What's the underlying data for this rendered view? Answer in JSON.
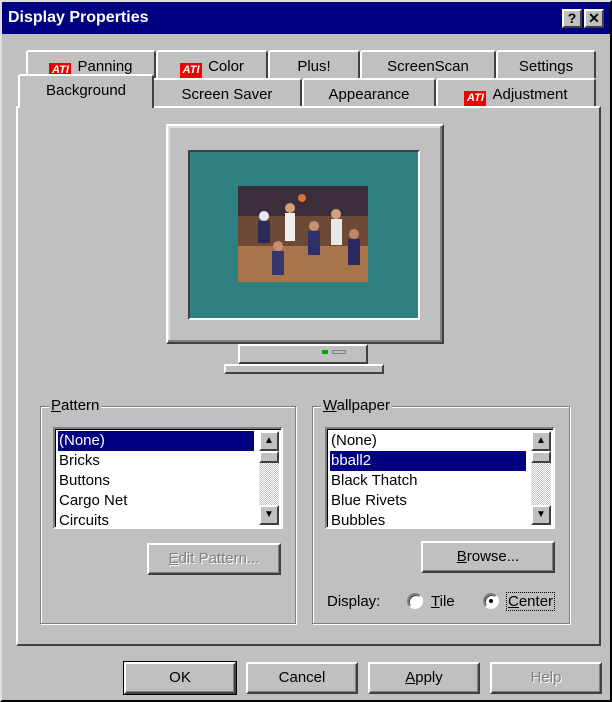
{
  "window": {
    "title": "Display Properties",
    "help_glyph": "?",
    "close_glyph": "✕"
  },
  "tabs_back": [
    {
      "label": "Panning",
      "ati": true
    },
    {
      "label": "Color",
      "ati": true
    },
    {
      "label": "Plus!",
      "ati": false
    },
    {
      "label": "ScreenScan",
      "ati": false
    },
    {
      "label": "Settings",
      "ati": false
    }
  ],
  "tabs_front": [
    {
      "label": "Background",
      "ati": false,
      "active": true
    },
    {
      "label": "Screen Saver",
      "ati": false
    },
    {
      "label": "Appearance",
      "ati": false
    },
    {
      "label": "Adjustment",
      "ati": true
    }
  ],
  "ati_logo_text": "ATI",
  "pattern": {
    "group_label_ul": "P",
    "group_label_rest": "attern",
    "items": [
      "(None)",
      "Bricks",
      "Buttons",
      "Cargo Net",
      "Circuits"
    ],
    "selected": "(None)",
    "edit_button_ul": "E",
    "edit_button_rest": "dit Pattern..."
  },
  "wallpaper": {
    "group_label_ul": "W",
    "group_label_rest": "allpaper",
    "items": [
      "(None)",
      "bball2",
      "Black Thatch",
      "Blue Rivets",
      "Bubbles"
    ],
    "selected": "bball2",
    "browse_ul": "B",
    "browse_rest": "rowse...",
    "display_label": "Display:",
    "display_ul_index": 0,
    "options": [
      {
        "ul": "T",
        "rest": "ile",
        "checked": false
      },
      {
        "ul": "C",
        "rest": "enter",
        "checked": true
      }
    ]
  },
  "buttons": {
    "ok": "OK",
    "cancel": "Cancel",
    "apply_ul": "A",
    "apply_rest": "pply",
    "help": "Help"
  },
  "scroll": {
    "up": "▲",
    "down": "▼"
  }
}
